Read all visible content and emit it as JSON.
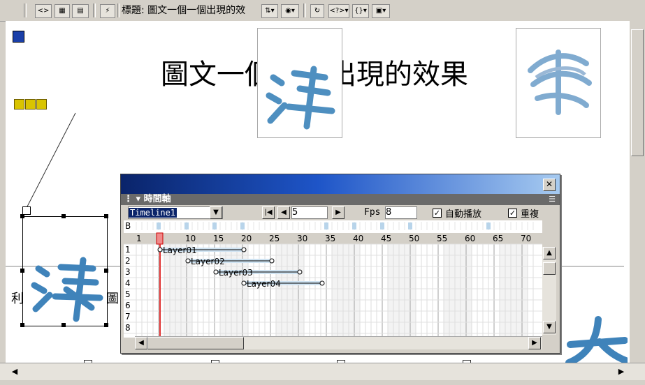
{
  "toolbar": {
    "title_label": "標題: 圖文一個一個出現的效",
    "buttons": [
      "code-view-icon",
      "split-view-icon",
      "design-view-icon",
      "lightning-icon"
    ],
    "right_buttons": [
      "file-manage-icon",
      "preview-globe-icon",
      "refresh-icon",
      "code-nav-icon",
      "braces-icon",
      "view-options-icon"
    ]
  },
  "document": {
    "page_title": "圖文一個一個出現的效果",
    "left_char_partial": "利",
    "right_char_partial": "圖"
  },
  "timeline": {
    "panel_title": "時間軸",
    "selected_timeline": "Timeline1",
    "frame_number": "5",
    "fps_label": "Fps",
    "fps_value": "8",
    "autoplay_label": "自動播放",
    "autoplay_checked": true,
    "loop_label": "重複",
    "loop_checked": true,
    "behavior_row_label": "B",
    "frame_ticks": [
      "1",
      "5",
      "10",
      "15",
      "20",
      "25",
      "30",
      "35",
      "40",
      "45",
      "50",
      "55",
      "60",
      "65",
      "70"
    ],
    "row_numbers": [
      "1",
      "2",
      "3",
      "4",
      "5",
      "6",
      "7",
      "8"
    ],
    "layers": [
      {
        "name": "Layer01",
        "row": 1,
        "start": 5,
        "end": 20
      },
      {
        "name": "Layer02",
        "row": 2,
        "start": 10,
        "end": 25
      },
      {
        "name": "Layer03",
        "row": 3,
        "start": 15,
        "end": 30
      },
      {
        "name": "Layer04",
        "row": 4,
        "start": 20,
        "end": 34
      }
    ],
    "playhead_frame": 5,
    "total_frames_visible": 72
  }
}
